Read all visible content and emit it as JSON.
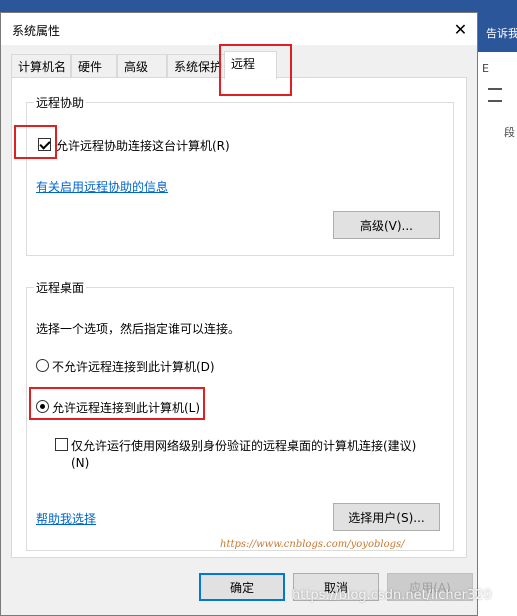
{
  "background_app": {
    "tell_me": "告诉我",
    "ribbon_mark": "E",
    "ribbon_label": "段"
  },
  "dialog": {
    "title": "系统属性",
    "close_glyph": "✕",
    "tabs": [
      {
        "label": "计算机名"
      },
      {
        "label": "硬件"
      },
      {
        "label": "高级"
      },
      {
        "label": "系统保护"
      },
      {
        "label": "远程",
        "active": true
      }
    ],
    "remote_assistance": {
      "group_title": "远程协助",
      "checkbox_label": "允许远程协助连接这台计算机(R)",
      "checked": true,
      "info_link": "有关启用远程协助的信息",
      "advanced_button": "高级(V)..."
    },
    "remote_desktop": {
      "group_title": "远程桌面",
      "instruction": "选择一个选项，然后指定谁可以连接。",
      "options": [
        {
          "label": "不允许远程连接到此计算机(D)",
          "selected": false
        },
        {
          "label": "允许远程连接到此计算机(L)",
          "selected": true
        }
      ],
      "nla_label_line1": "仅允许运行使用网络级别身份验证的远程桌面的计算机连接(建议)",
      "nla_label_line2": "(N)",
      "nla_checked": false,
      "help_link": "帮助我选择",
      "select_users_button": "选择用户(S)..."
    },
    "buttons": {
      "ok": "确定",
      "cancel": "取消",
      "apply": "应用(A)"
    }
  },
  "watermarks": {
    "cnblogs": "https://www.cnblogs.com/yoyoblogs/",
    "csdn": "https://blog.csdn.net/licher320"
  },
  "colors": {
    "accent": "#0078d7",
    "link": "#0066cc",
    "annotation": "#e02020",
    "app_blue": "#2b579a"
  }
}
